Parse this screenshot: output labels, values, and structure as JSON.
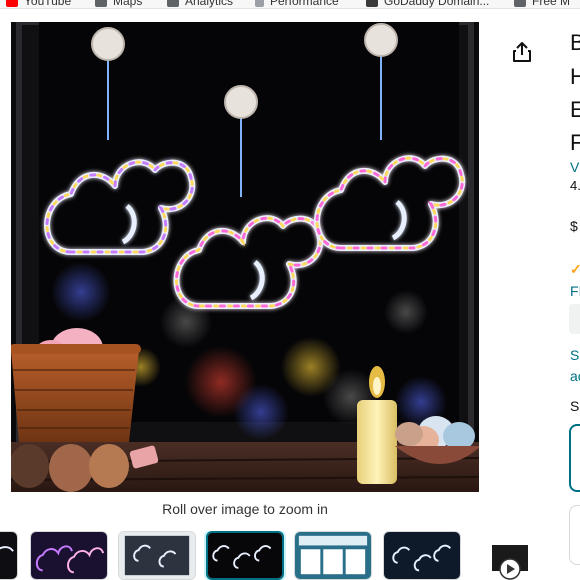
{
  "bookmarks": [
    {
      "label": "YouTube",
      "icon": "youtube-icon"
    },
    {
      "label": "Maps",
      "icon": "globe-icon"
    },
    {
      "label": "Analytics",
      "icon": "globe-icon"
    },
    {
      "label": "Performance",
      "icon": "doc-icon"
    },
    {
      "label": "GoDaddy Domain...",
      "icon": "globe-icon"
    },
    {
      "label": "Free M",
      "icon": "globe-icon"
    }
  ],
  "gallery": {
    "zoom_caption": "Roll over image to zoom in",
    "selected_index": 3
  },
  "detail": {
    "title_lines": [
      "B",
      "H",
      "E",
      "F"
    ],
    "link_text": "V",
    "rating_text": "4.",
    "price_text": "$",
    "prime_check": "✓",
    "free_text": "FI",
    "sa_text": "Sa",
    "ad_text": "ac",
    "s_text": "S"
  },
  "colors": {
    "link": "#007185",
    "selected_border": "#007185",
    "prime": "#ffa41c"
  }
}
